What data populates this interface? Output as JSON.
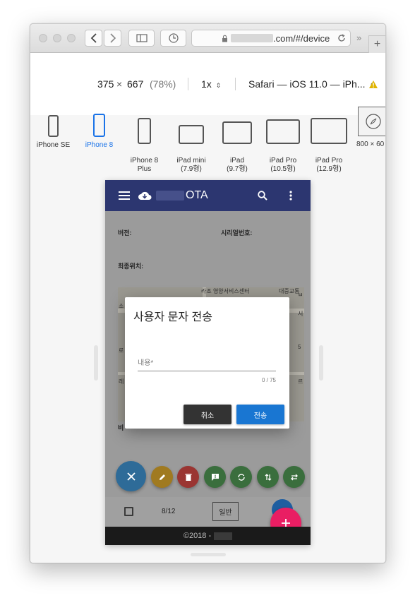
{
  "browser": {
    "url_suffix": ".com/#/device",
    "reader_more": "»",
    "new_tab": "+"
  },
  "rdm": {
    "width": "375",
    "times": "×",
    "height": "667",
    "scale": "(78%)",
    "pixel_ratio": "1x",
    "user_agent": "Safari — iOS 11.0 — iPh...",
    "devices": [
      {
        "label": "iPhone SE"
      },
      {
        "label": "iPhone 8"
      },
      {
        "label": "iPhone 8\nPlus"
      },
      {
        "label": "iPad mini\n(7.9형)"
      },
      {
        "label": "iPad\n(9.7형)"
      },
      {
        "label": "iPad Pro\n(10.5형)"
      },
      {
        "label": "iPad Pro\n(12.9형)"
      },
      {
        "label": "800 × 60"
      }
    ],
    "active_color": "#1a73e8"
  },
  "app": {
    "title": "OTA",
    "fields": {
      "version": "버전:",
      "serial": "시리얼번호:",
      "last_location": "최종위치:",
      "partial_label": "비"
    },
    "map_labels": [
      "라조 영양서비스센터",
      "대중교통",
      "소",
      "서",
      "로",
      "5",
      "레",
      "르",
      "ㅂ"
    ],
    "bottom": {
      "count": "8/12",
      "mode": "일반"
    },
    "footer": "©2018 -",
    "colors": {
      "appbar": "#2c3670",
      "fab_close": "#1e88e5",
      "fab_edit": "#f9a825",
      "fab_delete": "#e53935",
      "fab_green": "#43a047",
      "fab_add": "#e91e63",
      "cancel_btn": "#333333",
      "send_btn": "#1976d2"
    }
  },
  "dialog": {
    "title": "사용자 문자 전송",
    "input_label": "내용*",
    "counter": "0 / 75",
    "cancel": "취소",
    "send": "전송"
  }
}
